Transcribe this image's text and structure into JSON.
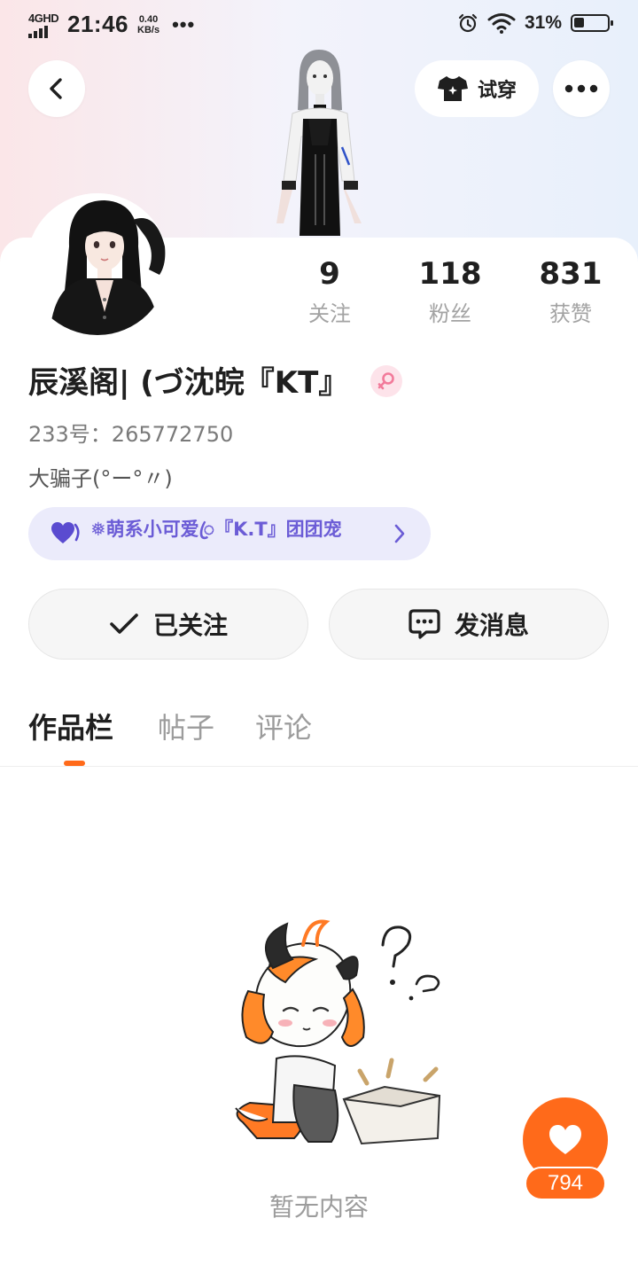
{
  "status_bar": {
    "network": "4GHD",
    "time": "21:46",
    "speed_value": "0.40",
    "speed_unit": "KB/s",
    "more": "•••",
    "battery_pct": "31%",
    "battery_level": 0.31
  },
  "header": {
    "try_on_label": "试穿"
  },
  "profile": {
    "following_count": "9",
    "following_label": "关注",
    "followers_count": "118",
    "followers_label": "粉丝",
    "likes_count": "831",
    "likes_label": "获赞",
    "nickname": "辰溪阁| (づ沈皖『KT』",
    "gender": "female",
    "uid": "233号：265772750",
    "bio": "大骗子(°ー°〃)",
    "group_text": "❅萌系小可爱ꦿ『K.T』团团宠"
  },
  "actions": {
    "followed_label": "已关注",
    "message_label": "发消息"
  },
  "tabs": [
    {
      "label": "作品栏",
      "active": true
    },
    {
      "label": "帖子",
      "active": false
    },
    {
      "label": "评论",
      "active": false
    }
  ],
  "empty_state": {
    "text": "暂无内容"
  },
  "like_fab": {
    "count": "794"
  },
  "colors": {
    "accent": "#ff6a1a",
    "group_text": "#6b5cd6",
    "group_bg": "#ebebfb",
    "gender_pink": "#f27a9a"
  }
}
